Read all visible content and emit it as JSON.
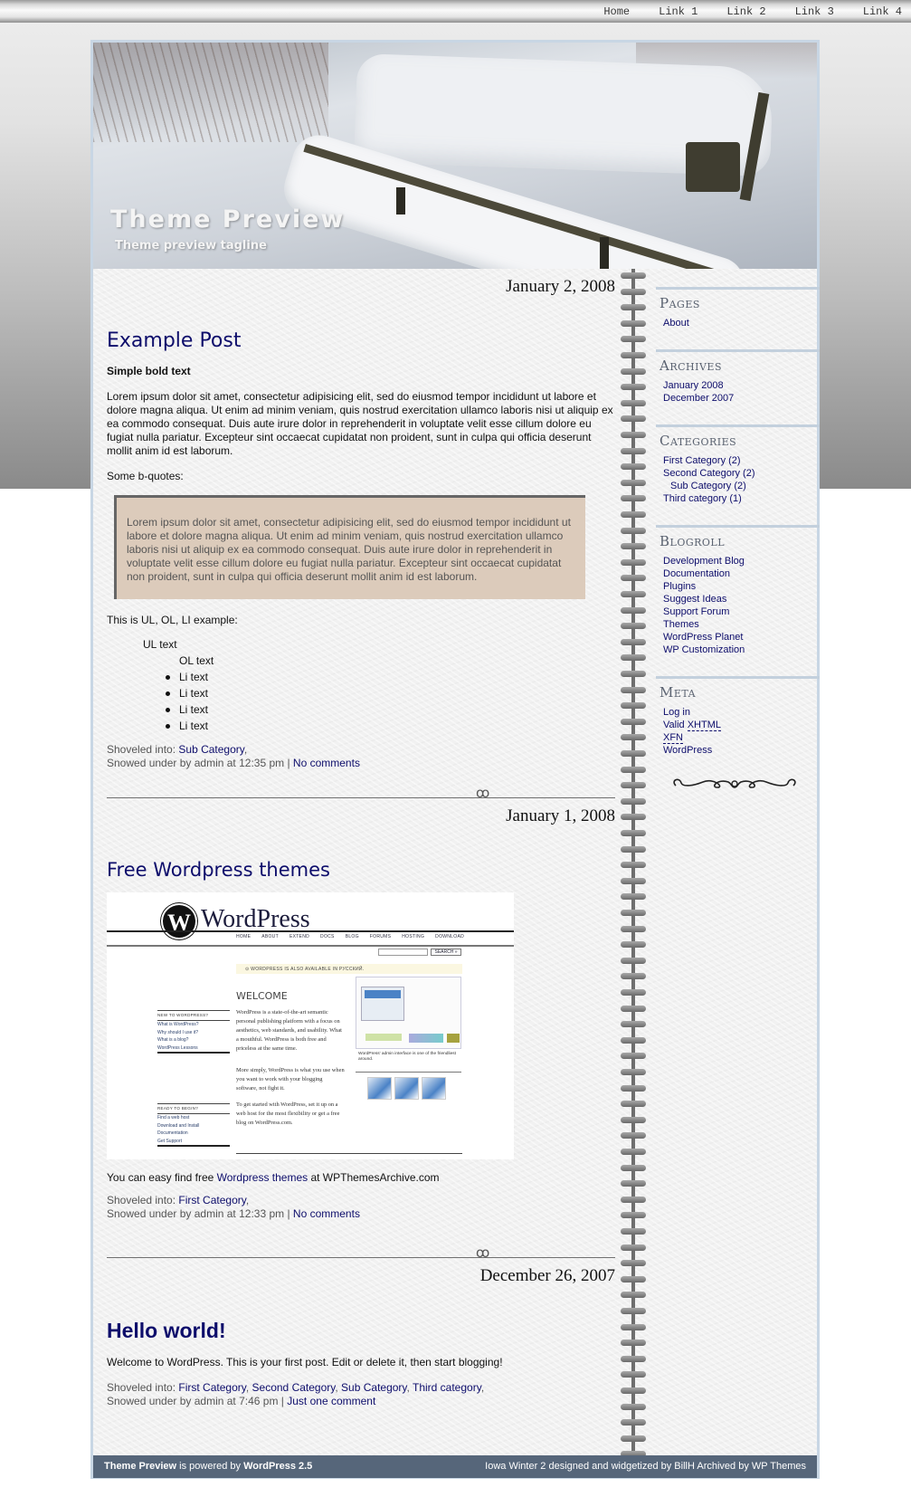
{
  "topnav": {
    "links": [
      "Home",
      "Link 1",
      "Link 2",
      "Link 3",
      "Link 4"
    ]
  },
  "header": {
    "title": "Theme Preview",
    "tagline": "Theme preview tagline"
  },
  "posts": [
    {
      "date": "January 2, 2008",
      "title": "Example Post",
      "bold_text": "Simple bold text",
      "paragraph": "Lorem ipsum dolor sit amet, consectetur adipisicing elit, sed do eiusmod tempor incididunt ut labore et dolore magna aliqua. Ut enim ad minim veniam, quis nostrud exercitation ullamco laboris nisi ut aliquip ex ea commodo consequat. Duis aute irure dolor in reprehenderit in voluptate velit esse cillum dolore eu fugiat nulla pariatur. Excepteur sint occaecat cupidatat non proident, sunt in culpa qui officia deserunt mollit anim id est laborum.",
      "bquote_intro": "Some b-quotes:",
      "blockquote": "Lorem ipsum dolor sit amet, consectetur adipisicing elit, sed do eiusmod tempor incididunt ut labore et dolore magna aliqua. Ut enim ad minim veniam, quis nostrud exercitation ullamco laboris nisi ut aliquip ex ea commodo consequat. Duis aute irure dolor in reprehenderit in voluptate velit esse cillum dolore eu fugiat nulla pariatur. Excepteur sint occaecat cupidatat non proident, sunt in culpa qui officia deserunt mollit anim id est laborum.",
      "list_intro": "This is UL, OL, LI example:",
      "ul_text": "UL text",
      "ol_text": "OL text",
      "li_items": [
        "Li text",
        "Li text",
        "Li text",
        "Li text"
      ],
      "meta_prefix": "Shoveled into: ",
      "categories": [
        "Sub Category"
      ],
      "byline": "Snowed under by admin at 12:35 pm | ",
      "comments": "No comments"
    },
    {
      "date": "January 1, 2008",
      "title": "Free Wordpress themes",
      "text_before": "You can easy find free ",
      "link_text": "Wordpress themes",
      "text_after": " at WPThemesArchive.com",
      "meta_prefix": "Shoveled into: ",
      "categories": [
        "First Category"
      ],
      "byline": "Snowed under by admin at 12:33 pm | ",
      "comments": "No comments",
      "image": {
        "logo_letter": "W",
        "logo_text": "WordPress",
        "menu": [
          "HOME",
          "ABOUT",
          "EXTEND",
          "DOCS",
          "BLOG",
          "FORUMS",
          "HOSTING",
          "DOWNLOAD"
        ],
        "search": "SEARCH »",
        "notice": "⊙ WORDPRESS IS ALSO AVAILABLE IN РУССКИЙ.",
        "welcome": "WELCOME",
        "para1": "WordPress is a state-of-the-art semantic personal publishing platform with a focus on aesthetics, web standards, and usability. What a mouthful. WordPress is both free and priceless at the same time.",
        "para2": "More simply, WordPress is what you use when you want to work with your blogging software, not fight it.",
        "para3": "To get started with WordPress, set it up on a web host for the most flexibility or get a free blog on WordPress.com.",
        "box1_title": "NEW TO WORDPRESS?",
        "box1_items": [
          "What is WordPress?",
          "Why should I use it?",
          "What is a blog?",
          "WordPress Lessons"
        ],
        "box2_title": "READY TO BEGIN?",
        "box2_items": [
          "Find a web host",
          "Download and Install",
          "Documentation",
          "Get Support"
        ],
        "caption": "WordPress' admin interface is one of the friendliest around."
      }
    },
    {
      "date": "December 26, 2007",
      "title": "Hello world!",
      "paragraph": "Welcome to WordPress. This is your first post. Edit or delete it, then start blogging!",
      "meta_prefix": "Shoveled into: ",
      "categories": [
        "First Category",
        "Second Category",
        "Sub Category",
        "Third category"
      ],
      "byline": "Snowed under by admin at 7:46 pm | ",
      "comments": "Just one comment"
    }
  ],
  "sidebar": {
    "pages": {
      "title": "Pages",
      "items": [
        "About"
      ]
    },
    "archives": {
      "title": "Archives",
      "items": [
        "January 2008",
        "December 2007"
      ]
    },
    "categories": {
      "title": "Categories",
      "items": [
        "First Category (2)",
        "Second Category (2)",
        "Sub Category (2)",
        "Third category (1)"
      ]
    },
    "blogroll": {
      "title": "Blogroll",
      "items": [
        "Development Blog",
        "Documentation",
        "Plugins",
        "Suggest Ideas",
        "Support Forum",
        "Themes",
        "WordPress Planet",
        "WP Customization"
      ]
    },
    "meta": {
      "title": "Meta",
      "items": [
        "Log in",
        "Valid ",
        "XHTML",
        "XFN",
        "WordPress"
      ]
    }
  },
  "footer": {
    "site_name": "Theme Preview",
    "powered_text": " is powered by ",
    "wp_version": "WordPress 2.5",
    "credits": "Iowa Winter 2 designed and widgetized by BillH Archived by WP Themes"
  }
}
